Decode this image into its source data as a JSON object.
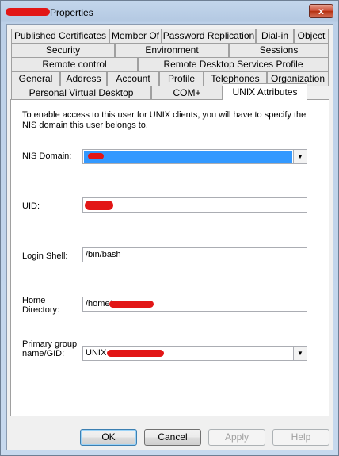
{
  "window": {
    "title": "Properties",
    "close_glyph": "x"
  },
  "tabs": {
    "row1": [
      "Published Certificates",
      "Member Of",
      "Password Replication",
      "Dial-in",
      "Object"
    ],
    "row2": [
      "Security",
      "Environment",
      "Sessions"
    ],
    "row3": [
      "Remote control",
      "Remote Desktop Services Profile"
    ],
    "row4": [
      "General",
      "Address",
      "Account",
      "Profile",
      "Telephones",
      "Organization"
    ],
    "row5": [
      "Personal Virtual Desktop",
      "COM+",
      "UNIX Attributes"
    ]
  },
  "unix": {
    "description": "To enable access to this user for UNIX clients, you will have to specify the NIS domain this user belongs to.",
    "nis_domain_label": "NIS Domain:",
    "uid_label": "UID:",
    "login_shell_label": "Login Shell:",
    "login_shell_value": "/bin/bash",
    "home_dir_label_1": "Home",
    "home_dir_label_2": "Directory:",
    "home_dir_value": "/home/",
    "primary_group_label_1": "Primary group",
    "primary_group_label_2": "name/GID:",
    "primary_group_value": "UNIX"
  },
  "buttons": {
    "ok": "OK",
    "cancel": "Cancel",
    "apply": "Apply",
    "help": "Help"
  },
  "colors": {
    "redaction": "#e21616",
    "selection": "#3399ff"
  }
}
